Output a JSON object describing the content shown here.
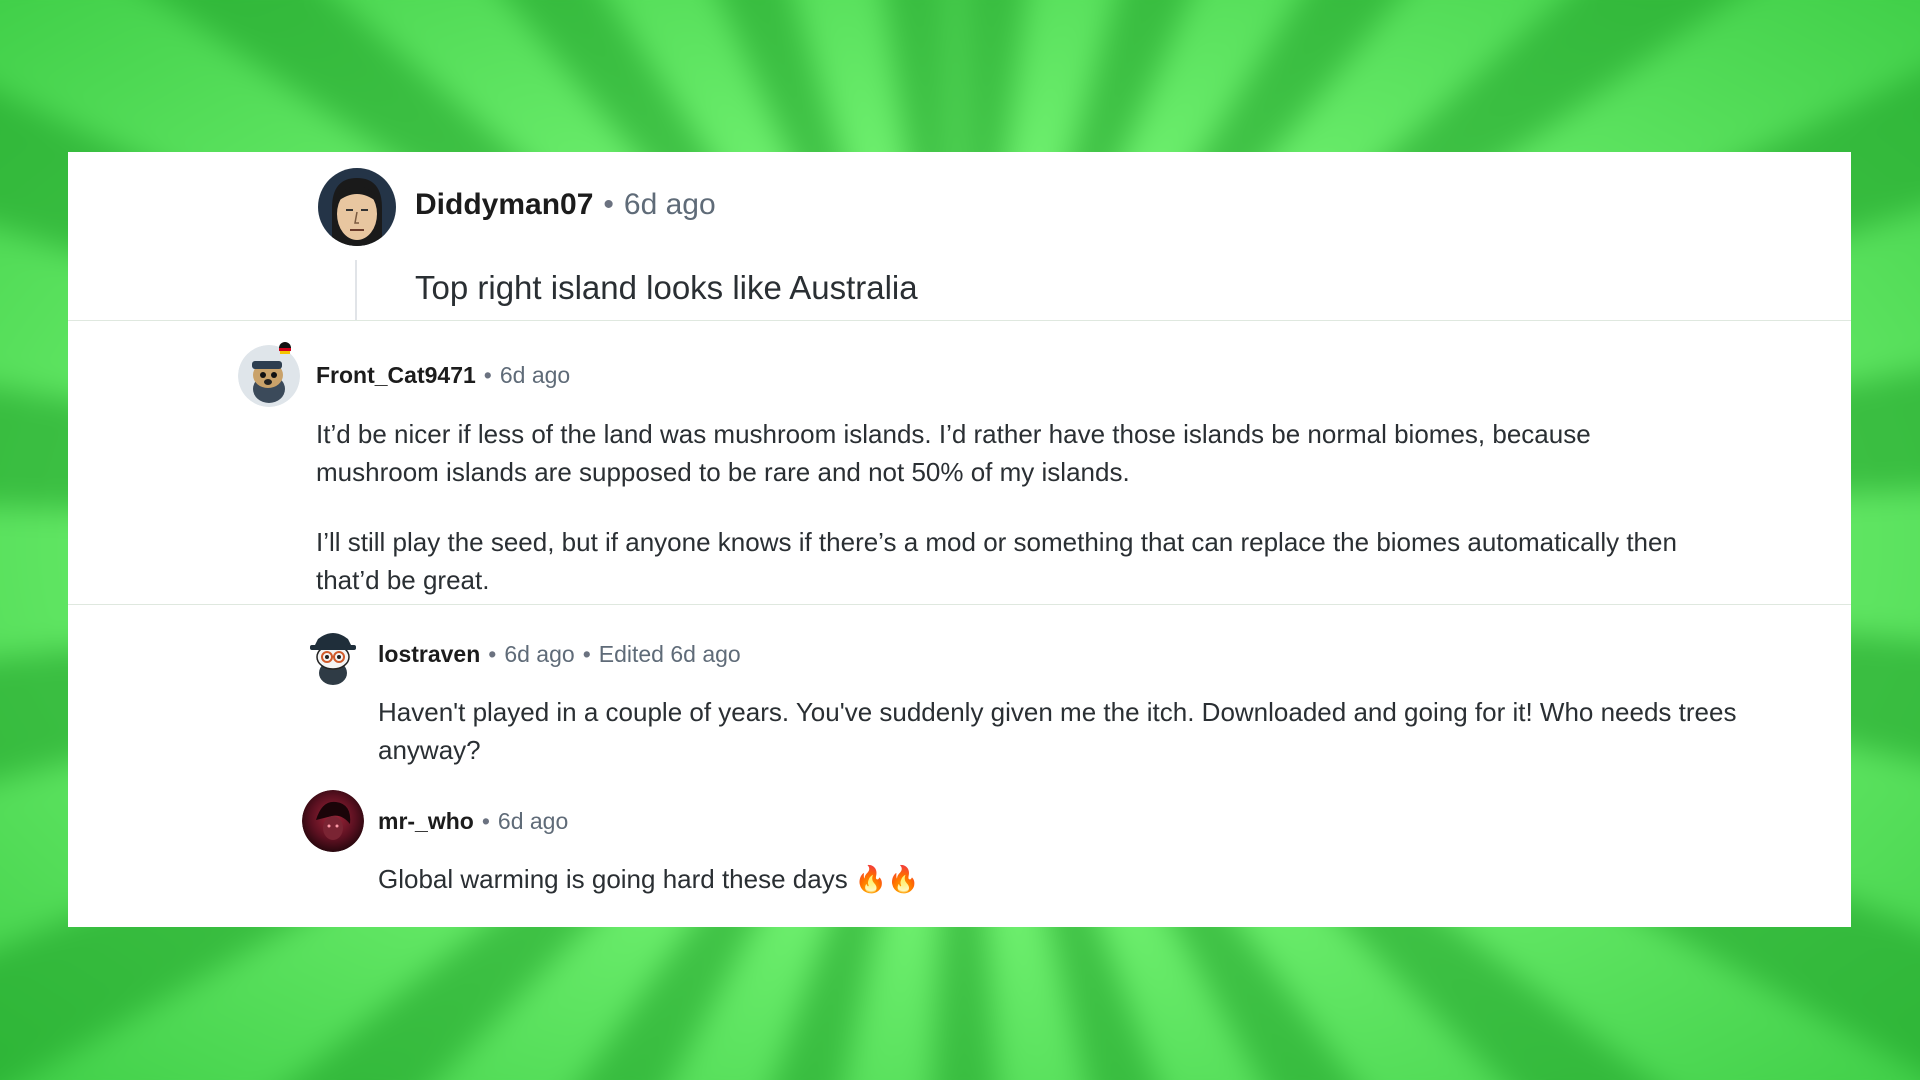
{
  "comments": [
    {
      "username": "Diddyman07",
      "time": "6d ago",
      "body": "Top right island looks like Australia"
    },
    {
      "username": "Front_Cat9471",
      "time": "6d ago",
      "paragraph1": "It’d be nicer if less of the land was mushroom islands. I’d rather have those islands be normal biomes, because mushroom islands are supposed to be rare and not 50% of my islands.",
      "paragraph2": "I’ll still play the seed, but if anyone knows if there’s a mod or something that can replace the biomes automatically then that’d be great."
    },
    {
      "username": "lostraven",
      "time": "6d ago",
      "edited": "Edited 6d ago",
      "body": "Haven't played in a couple of years. You've suddenly given me the itch. Downloaded and going for it! Who needs trees anyway?"
    },
    {
      "username": "mr-_who",
      "time": "6d ago",
      "body": "Global warming is going hard these days 🔥🔥"
    }
  ],
  "separator": "•",
  "colors": {
    "background": "#67ee6a",
    "card": "#ffffff",
    "username": "#1c1c1c",
    "meta": "#5f6b78",
    "body": "#2a2f33"
  }
}
